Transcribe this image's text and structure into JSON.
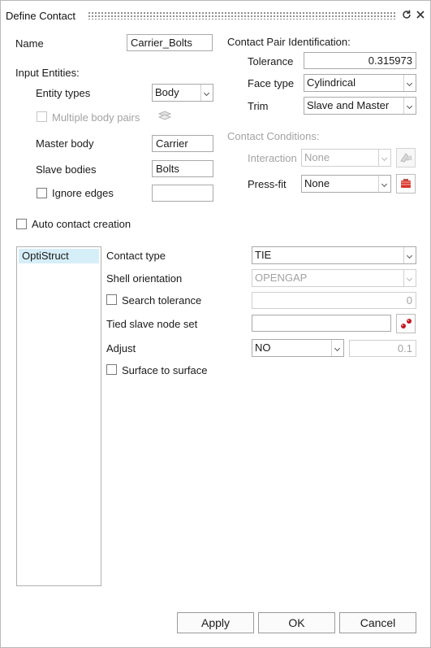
{
  "window": {
    "title": "Define Contact",
    "reset_icon": "reset-icon",
    "close_icon": "close-icon"
  },
  "left": {
    "name_label": "Name",
    "name_value": "Carrier_Bolts",
    "input_entities_label": "Input Entities:",
    "entity_types_label": "Entity types",
    "entity_types_value": "Body",
    "multiple_body_pairs_label": "Multiple body pairs",
    "master_body_label": "Master body",
    "master_body_value": "Carrier",
    "slave_bodies_label": "Slave bodies",
    "slave_bodies_value": "Bolts",
    "ignore_edges_label": "Ignore edges",
    "ignore_edges_value": ""
  },
  "right": {
    "pair_id_label": "Contact Pair Identification:",
    "tolerance_label": "Tolerance",
    "tolerance_value": "0.315973",
    "face_type_label": "Face type",
    "face_type_value": "Cylindrical",
    "trim_label": "Trim",
    "trim_value": "Slave and Master",
    "conditions_label": "Contact Conditions:",
    "interaction_label": "Interaction",
    "interaction_value": "None",
    "pressfit_label": "Press-fit",
    "pressfit_value": "None"
  },
  "auto_contact_label": "Auto contact creation",
  "solver_list": [
    "OptiStruct"
  ],
  "props": {
    "contact_type_label": "Contact  type",
    "contact_type_value": "TIE",
    "shell_orientation_label": "Shell orientation",
    "shell_orientation_value": "OPENGAP",
    "search_tolerance_label": "Search tolerance",
    "search_tolerance_value": "0",
    "tied_slave_label": "Tied slave node set",
    "tied_slave_value": "",
    "adjust_label": "Adjust",
    "adjust_value": "NO",
    "adjust_number": "0.1",
    "surface_to_surface_label": "Surface to surface"
  },
  "buttons": {
    "apply": "Apply",
    "ok": "OK",
    "cancel": "Cancel"
  },
  "colors": {
    "selection": "#d6eef8",
    "pressfit_icon": "#d9342b",
    "node_icon": "#c0161f"
  }
}
